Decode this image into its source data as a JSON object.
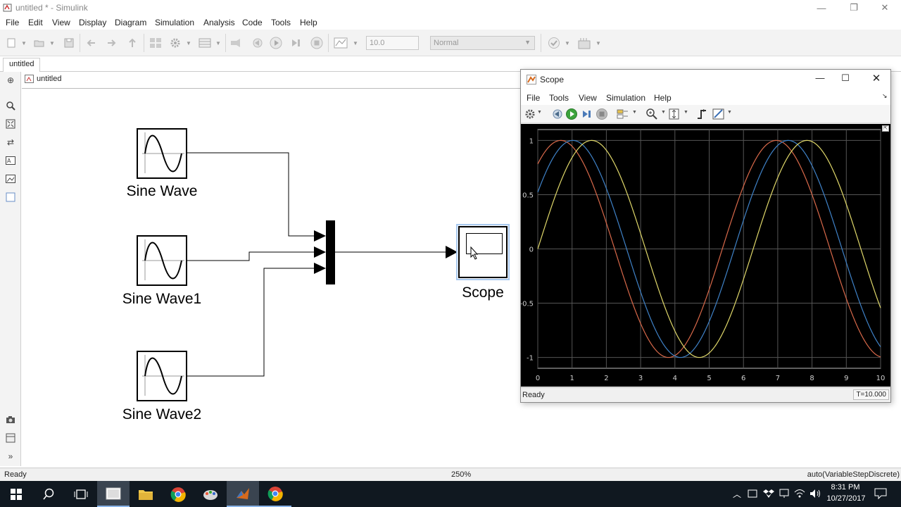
{
  "window": {
    "title": "untitled * - Simulink",
    "controls": [
      "—",
      "❐",
      "✕"
    ]
  },
  "menu": [
    "File",
    "Edit",
    "View",
    "Display",
    "Diagram",
    "Simulation",
    "Analysis",
    "Code",
    "Tools",
    "Help"
  ],
  "toolbar": {
    "stop_time": "10.0",
    "sim_mode": "Normal"
  },
  "tab": "untitled",
  "breadcrumb": "untitled",
  "blocks": [
    {
      "label": "Sine Wave"
    },
    {
      "label": "Sine Wave1"
    },
    {
      "label": "Sine Wave2"
    },
    {
      "label": "Scope"
    }
  ],
  "status": {
    "left": "Ready",
    "zoom": "250%",
    "solver": "auto(VariableStepDiscrete)"
  },
  "scope": {
    "title": "Scope",
    "menu": [
      "File",
      "Tools",
      "View",
      "Simulation",
      "Help"
    ],
    "status_left": "Ready",
    "status_right": "T=10.000"
  },
  "chart_data": {
    "type": "line",
    "xlim": [
      0,
      10
    ],
    "ylim": [
      -1.1,
      1.1
    ],
    "x_ticks": [
      0,
      1,
      2,
      3,
      4,
      5,
      6,
      7,
      8,
      9,
      10
    ],
    "y_ticks": [
      1,
      0.5,
      0,
      -0.5,
      -1
    ],
    "y_tick_labels": [
      "1",
      "0.5",
      "0",
      "-0.5",
      "-1"
    ],
    "grid": true,
    "series": [
      {
        "color": "#d9694a",
        "amplitude": 1,
        "phase": 0.9
      },
      {
        "color": "#3f82c8",
        "amplitude": 1,
        "phase": 0.55
      },
      {
        "color": "#e0d86a",
        "amplitude": 1,
        "phase": 0.0
      }
    ]
  },
  "taskbar": {
    "time": "8:31 PM",
    "date": "10/27/2017"
  },
  "colors": {
    "accent": "#1e6fd0",
    "taskbar": "#101820",
    "selection": "#a9c9ef"
  }
}
